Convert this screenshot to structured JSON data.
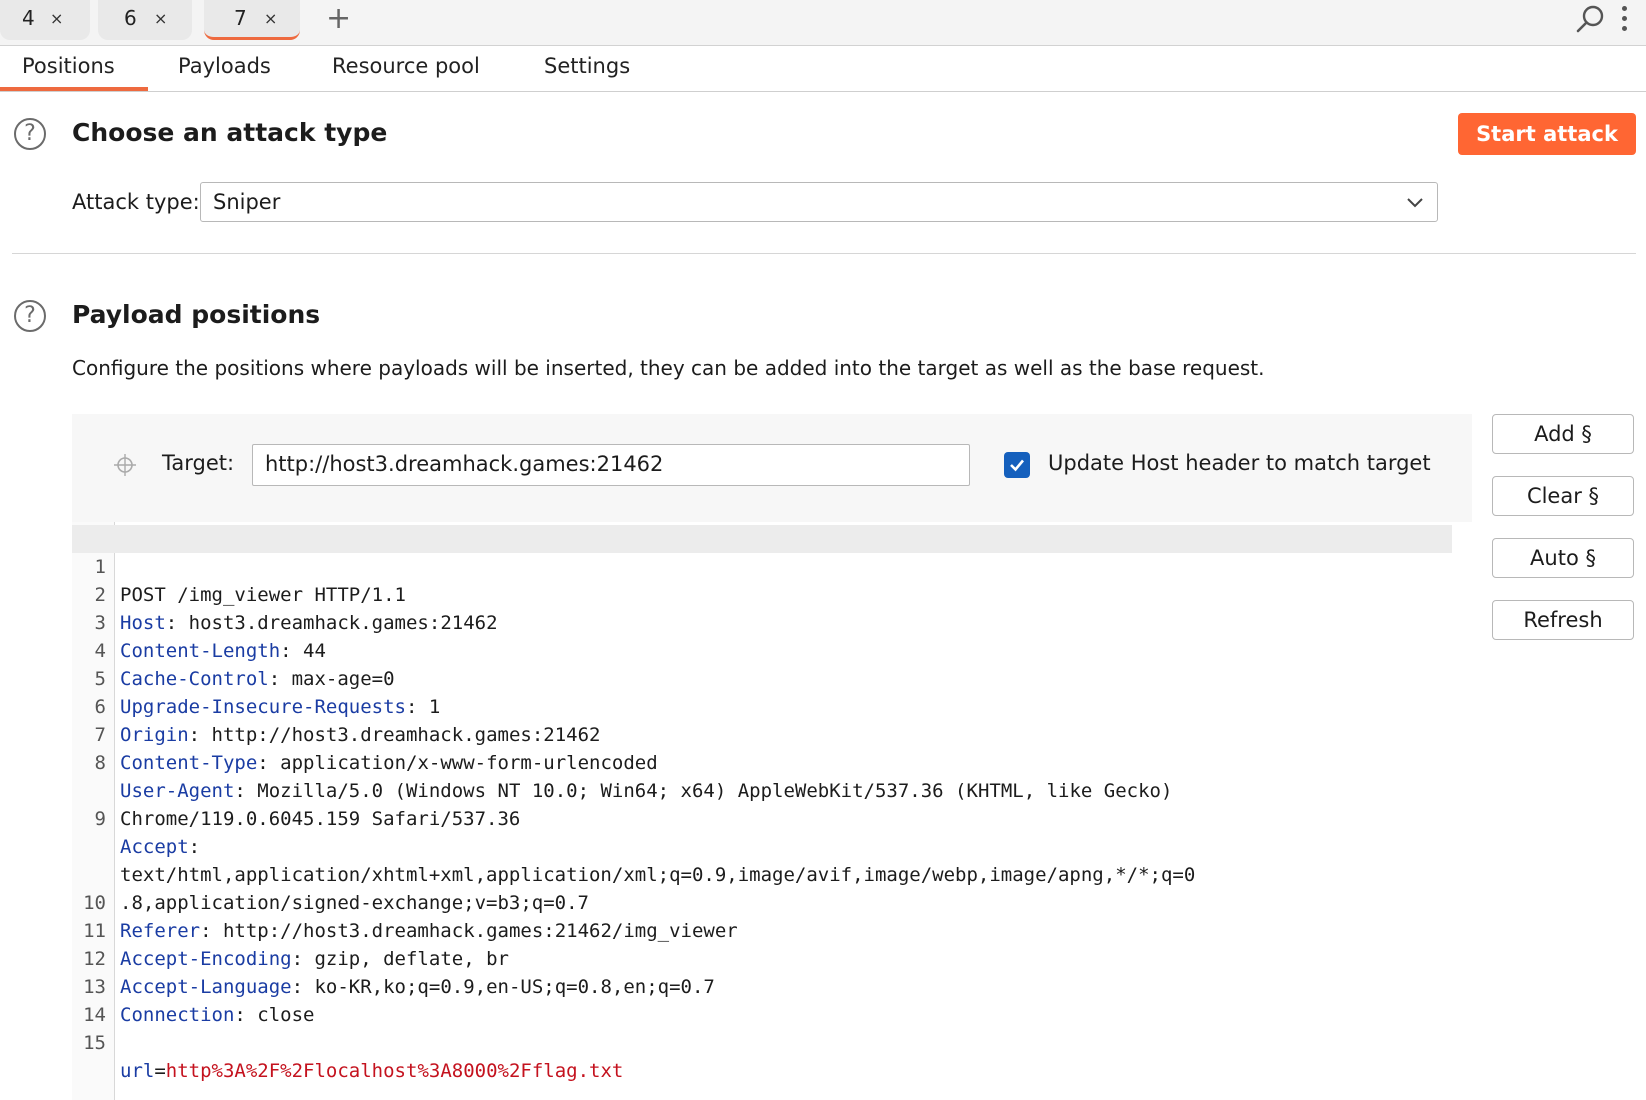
{
  "window_tabs": [
    {
      "label": "4",
      "close": "×"
    },
    {
      "label": "6",
      "close": "×"
    },
    {
      "label": "7",
      "close": "×",
      "active": true
    }
  ],
  "new_tab": "+",
  "sub_tabs": [
    "Positions",
    "Payloads",
    "Resource pool",
    "Settings"
  ],
  "attack_section": {
    "help": "?",
    "title": "Choose an attack type",
    "start_button": "Start attack",
    "attack_type_label": "Attack type:",
    "attack_type_value": "Sniper"
  },
  "positions_section": {
    "help": "?",
    "title": "Payload positions",
    "description": "Configure the positions where payloads will be inserted, they can be added into the target as well as the base request.",
    "target_label": "Target:",
    "target_value": "http://host3.dreamhack.games:21462",
    "update_host_label": "Update Host header to match target",
    "update_host_checked": true
  },
  "side_buttons": {
    "add": "Add §",
    "clear": "Clear §",
    "auto": "Auto §",
    "refresh": "Refresh"
  },
  "request_lines": [
    {
      "n": "1",
      "text": "POST /img_viewer HTTP/1.1"
    },
    {
      "n": "2",
      "key": "Host",
      "value": " host3.dreamhack.games:21462"
    },
    {
      "n": "3",
      "key": "Content-Length",
      "value": " 44"
    },
    {
      "n": "4",
      "key": "Cache-Control",
      "value": " max-age=0"
    },
    {
      "n": "5",
      "key": "Upgrade-Insecure-Requests",
      "value": " 1"
    },
    {
      "n": "6",
      "key": "Origin",
      "value": " http://host3.dreamhack.games:21462"
    },
    {
      "n": "7",
      "key": "Content-Type",
      "value": " application/x-www-form-urlencoded"
    },
    {
      "n": "8",
      "key": "User-Agent",
      "value": " Mozilla/5.0 (Windows NT 10.0; Win64; x64) AppleWebKit/537.36 (KHTML, like Gecko)"
    },
    {
      "n": "",
      "text": "Chrome/119.0.6045.159 Safari/537.36"
    },
    {
      "n": "9",
      "key": "Accept",
      "value": ""
    },
    {
      "n": "",
      "text": "text/html,application/xhtml+xml,application/xml;q=0.9,image/avif,image/webp,image/apng,*/*;q=0"
    },
    {
      "n": "",
      "text": ".8,application/signed-exchange;v=b3;q=0.7"
    },
    {
      "n": "10",
      "key": "Referer",
      "value": " http://host3.dreamhack.games:21462/img_viewer"
    },
    {
      "n": "11",
      "key": "Accept-Encoding",
      "value": " gzip, deflate, br"
    },
    {
      "n": "12",
      "key": "Accept-Language",
      "value": " ko-KR,ko;q=0.9,en-US;q=0.8,en;q=0.7"
    },
    {
      "n": "13",
      "key": "Connection",
      "value": " close"
    },
    {
      "n": "14",
      "text": ""
    },
    {
      "n": "15",
      "param_key": "url",
      "param_value": "http%3A%2F%2Flocalhost%3A8000%2Fflag.txt"
    }
  ],
  "colors": {
    "accent": "#ff6633",
    "tab_underline": "#ee6a3f",
    "header_key": "#1a3ca3",
    "param_value": "#c4121e",
    "checkbox": "#1560bd"
  },
  "icons": [
    "search-icon",
    "more-icon",
    "help-icon",
    "chevron-down-icon",
    "crosshair-icon",
    "check-icon",
    "close-icon",
    "plus-icon"
  ]
}
